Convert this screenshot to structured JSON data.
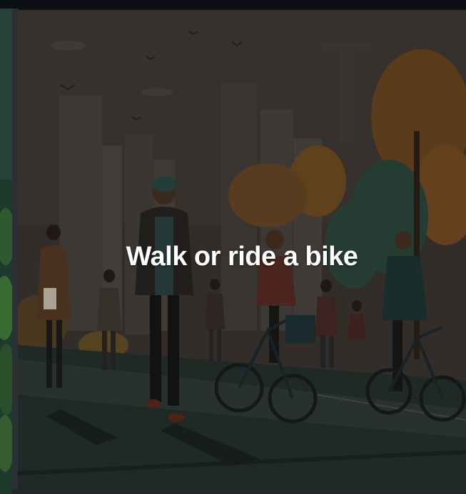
{
  "card": {
    "title": "Walk or ride a bike",
    "image": "people-walking-and-cycling-city-park-illustration"
  },
  "colors": {
    "background": "#101214",
    "title_text": "#ffffff",
    "frame": "#2c2f35"
  }
}
